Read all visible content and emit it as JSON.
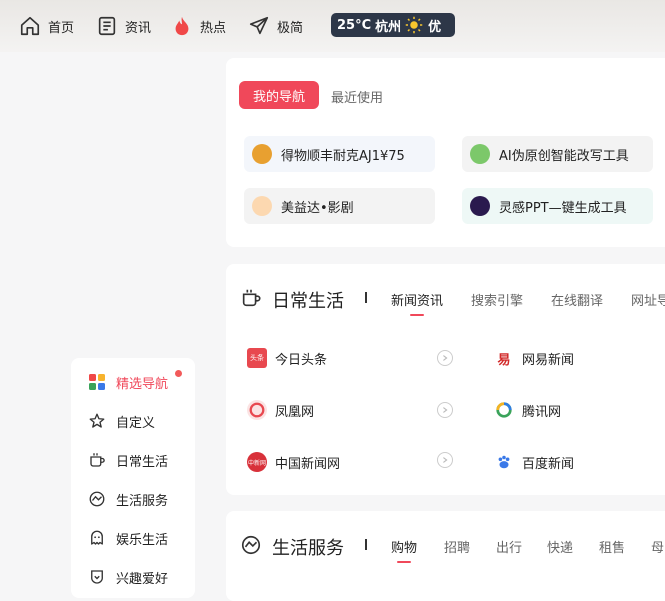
{
  "topnav": {
    "items": [
      {
        "label": "首页",
        "icon": "home-icon"
      },
      {
        "label": "资讯",
        "icon": "news-icon"
      },
      {
        "label": "热点",
        "icon": "fire-icon"
      },
      {
        "label": "极简",
        "icon": "paper-plane-icon"
      }
    ],
    "weather": {
      "temp": "25°C",
      "city": "杭州",
      "icon": "sun-icon",
      "quality": "优"
    }
  },
  "my_nav": {
    "tabs": {
      "active": "我的导航",
      "recent": "最近使用"
    },
    "links": [
      {
        "label": "得物顺丰耐克AJ1¥75",
        "color": "#e8a030"
      },
      {
        "label": "AI伪原创智能改写工具",
        "color": "#7cc86a"
      },
      {
        "label": "美益达•影剧",
        "color": "#f7b36b"
      },
      {
        "label": "灵感PPT—键生成工具",
        "color": "#2a1a4e"
      }
    ]
  },
  "daily": {
    "title": "日常生活",
    "tabs": [
      "新闻资讯",
      "搜索引擎",
      "在线翻译",
      "网址导"
    ],
    "sites": [
      {
        "label": "今日头条",
        "color": "#e8484f",
        "badge": "头条"
      },
      {
        "label": "网易新闻",
        "color": "#d22a2a",
        "badge": "易"
      },
      {
        "label": "凤凰网",
        "color": "#e8484f",
        "badge": ""
      },
      {
        "label": "腾讯网",
        "color": "#3aa35a",
        "badge": ""
      },
      {
        "label": "中国新闻网",
        "color": "#d8313a",
        "badge": "中新网"
      },
      {
        "label": "百度新闻",
        "color": "#3a79e8",
        "badge": ""
      }
    ]
  },
  "life": {
    "title": "生活服务",
    "tabs": [
      "购物",
      "招聘",
      "出行",
      "快递",
      "租售",
      "母"
    ]
  },
  "sidebar": {
    "items": [
      {
        "label": "精选导航"
      },
      {
        "label": "自定义"
      },
      {
        "label": "日常生活"
      },
      {
        "label": "生活服务"
      },
      {
        "label": "娱乐生活"
      },
      {
        "label": "兴趣爱好"
      }
    ]
  },
  "colors": {
    "accent": "#f0485a",
    "weather_bg": "#2d3748"
  }
}
